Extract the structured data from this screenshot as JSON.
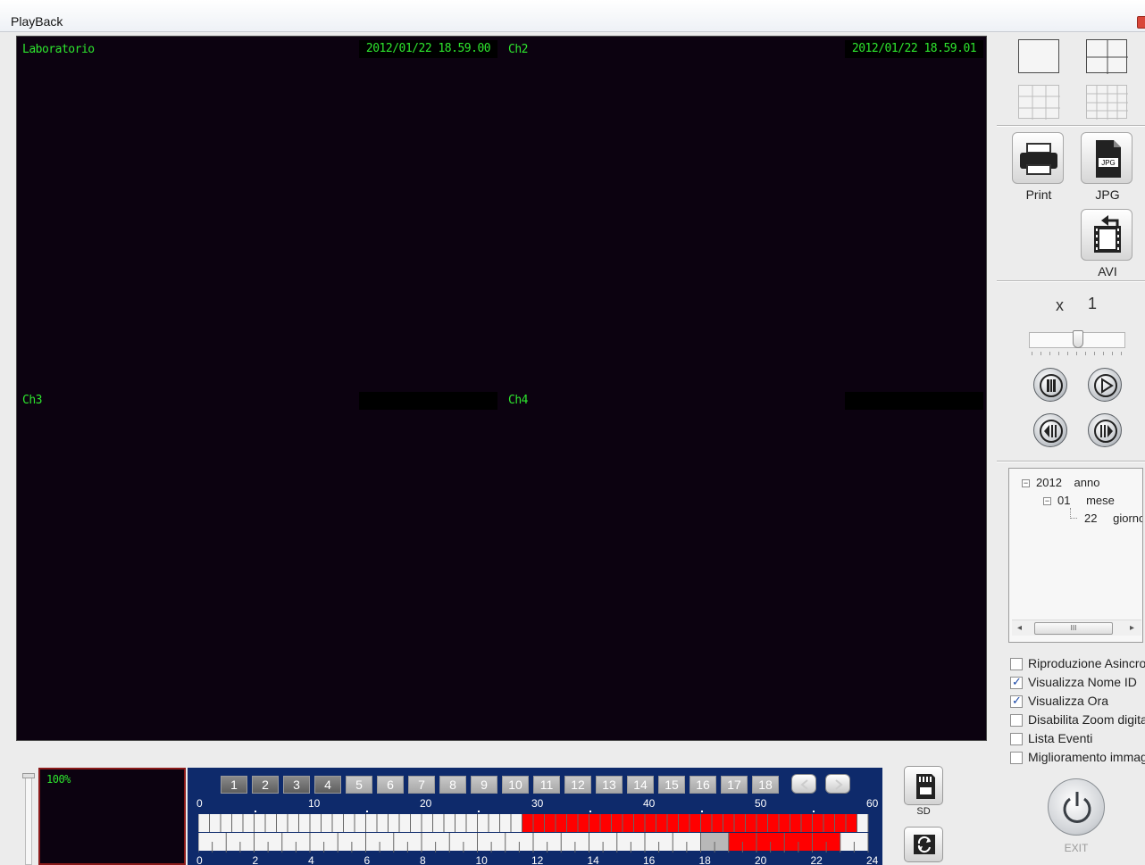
{
  "window": {
    "title": "PlayBack"
  },
  "video": {
    "channels": [
      {
        "name": "Laboratorio",
        "timestamp": "2012/01/22 18.59.00"
      },
      {
        "name": "Ch2",
        "timestamp": "2012/01/22 18.59.01"
      },
      {
        "name": "Ch3",
        "timestamp": ""
      },
      {
        "name": "Ch4",
        "timestamp": ""
      }
    ]
  },
  "tools": {
    "print_label": "Print",
    "jpg_label": "JPG",
    "avi_label": "AVI",
    "jpg_icon_text": "JPG"
  },
  "speed": {
    "prefix": "x",
    "value": "1",
    "slider_position": 0.5
  },
  "tree": {
    "year": {
      "value": "2012",
      "label": "anno"
    },
    "month": {
      "value": "01",
      "label": "mese"
    },
    "day": {
      "value": "22",
      "label": "giorno"
    },
    "scrollbar_thumb": "III"
  },
  "options": [
    {
      "label": "Riproduzione Asincrona",
      "checked": false
    },
    {
      "label": "Visualizza Nome ID",
      "checked": true
    },
    {
      "label": "Visualizza Ora",
      "checked": true
    },
    {
      "label": "Disabilita Zoom digitale",
      "checked": false
    },
    {
      "label": "Lista Eventi",
      "checked": false
    },
    {
      "label": "Miglioramento immagine",
      "checked": false
    }
  ],
  "exit_label": "EXIT",
  "zoom": {
    "label": "100%"
  },
  "channel_buttons": [
    "1",
    "2",
    "3",
    "4",
    "5",
    "6",
    "7",
    "8",
    "9",
    "10",
    "11",
    "12",
    "13",
    "14",
    "15",
    "16",
    "17",
    "18"
  ],
  "channel_buttons_active": 4,
  "minute_scale": [
    "0",
    "10",
    "20",
    "30",
    "40",
    "50",
    "60"
  ],
  "hour_scale": [
    "0",
    "2",
    "4",
    "6",
    "8",
    "10",
    "12",
    "14",
    "16",
    "18",
    "20",
    "22",
    "24"
  ],
  "recording": {
    "minutes_recorded": {
      "from": 29,
      "to": 59
    },
    "hours_grey": {
      "from": 18,
      "to": 19
    },
    "hours_recorded": {
      "from": 19,
      "to": 23
    }
  },
  "sd_label": "SD",
  "colors": {
    "record": "#ff0000",
    "timeline_bg": "#0e2a6b",
    "osd_green": "#2ee62e",
    "video_bg": "#0c0210"
  }
}
